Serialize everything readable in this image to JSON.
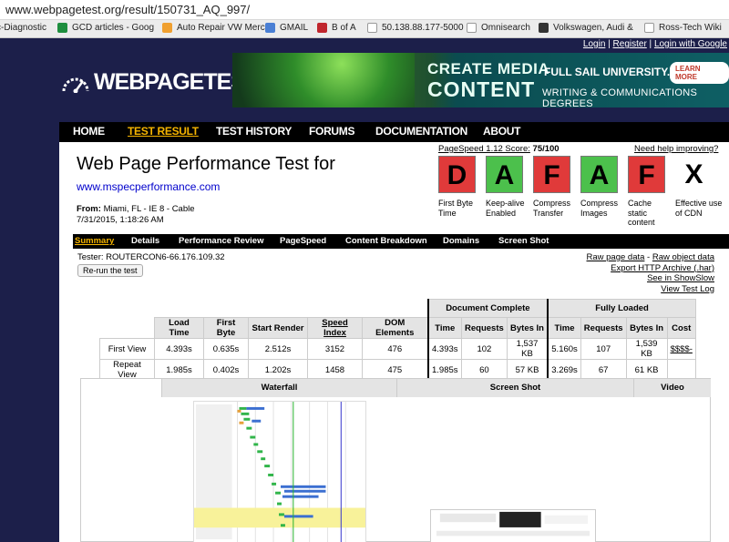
{
  "browser": {
    "url": "www.webpagetest.org/result/150731_AQ_997/",
    "bookmarks": [
      {
        "label": "c-Diagnostic",
        "color": "#1a6cc9"
      },
      {
        "label": "GCD articles - Goog",
        "color": "#1e8e3e"
      },
      {
        "label": "Auto Repair VW Merc",
        "color": "#f0a030"
      },
      {
        "label": "GMAIL",
        "color": "#4a7fd4"
      },
      {
        "label": "B of A",
        "color": "#c0262d"
      },
      {
        "label": "50.138.88.177-5000",
        "color": "#d0d0d0"
      },
      {
        "label": "Omnisearch",
        "color": "#d0d0d0"
      },
      {
        "label": "Volkswagen, Audi &",
        "color": "#333333"
      },
      {
        "label": "Ross-Tech Wiki",
        "color": "#d0d0d0"
      }
    ]
  },
  "header": {
    "login": "Login",
    "register": "Register",
    "login_google": "Login with Google",
    "logo_text": "WEBPAGETEST",
    "ad": {
      "line1": "CREATE MEDIA",
      "line2": "CONTENT",
      "school": "FULL SAIL UNIVERSITY.",
      "learn_more": "LEARN MORE",
      "tagline": "WRITING & COMMUNICATIONS DEGREES"
    }
  },
  "nav": [
    "HOME",
    "TEST RESULT",
    "TEST HISTORY",
    "FORUMS",
    "DOCUMENTATION",
    "ABOUT"
  ],
  "summary": {
    "title": "Web Page Performance Test for",
    "url": "www.mspecperformance.com",
    "from_label": "From:",
    "from_value": "Miami, FL - IE 8 - Cable",
    "date": "7/31/2015, 1:18:26 AM",
    "pagespeed_label": "PageSpeed 1.12 Score:",
    "pagespeed_score": "75/100",
    "help": "Need help improving?"
  },
  "grades": [
    {
      "letter": "D",
      "label": "First Byte Time",
      "color": "#e03a3a"
    },
    {
      "letter": "A",
      "label": "Keep-alive Enabled",
      "color": "#4cc04c"
    },
    {
      "letter": "F",
      "label": "Compress Transfer",
      "color": "#e03a3a"
    },
    {
      "letter": "A",
      "label": "Compress Images",
      "color": "#4cc04c"
    },
    {
      "letter": "F",
      "label": "Cache static content",
      "color": "#e03a3a"
    },
    {
      "letter": "X",
      "label": "Effective use of CDN",
      "color": "#ffffff"
    }
  ],
  "tabs": [
    "Summary",
    "Details",
    "Performance Review",
    "PageSpeed",
    "Content Breakdown",
    "Domains",
    "Screen Shot"
  ],
  "tester": "Tester: ROUTERCON6-66.176.109.32",
  "rerun": "Re-run the test",
  "right_links": {
    "raw_page": "Raw page data",
    "raw_object": "Raw object data",
    "export": "Export HTTP Archive (.har)",
    "showslow": "See in ShowSlow",
    "view_log": "View Test Log"
  },
  "results": {
    "doc_complete": "Document Complete",
    "fully_loaded": "Fully Loaded",
    "columns": [
      "Load Time",
      "First Byte",
      "Start Render",
      "Speed Index",
      "DOM Elements",
      "Time",
      "Requests",
      "Bytes In",
      "Time",
      "Requests",
      "Bytes In",
      "Cost"
    ],
    "rows": [
      {
        "label": "First View",
        "cells": [
          "4.393s",
          "0.635s",
          "2.512s",
          "3152",
          "476",
          "4.393s",
          "102",
          "1,537 KB",
          "5.160s",
          "107",
          "1,539 KB",
          "$$$$-"
        ]
      },
      {
        "label": "Repeat View",
        "cells": [
          "1.985s",
          "0.402s",
          "1.202s",
          "1458",
          "475",
          "1.985s",
          "60",
          "57 KB",
          "3.269s",
          "67",
          "61 KB",
          ""
        ]
      }
    ]
  },
  "bottom": {
    "waterfall": "Waterfall",
    "screenshot": "Screen Shot",
    "video": "Video"
  }
}
